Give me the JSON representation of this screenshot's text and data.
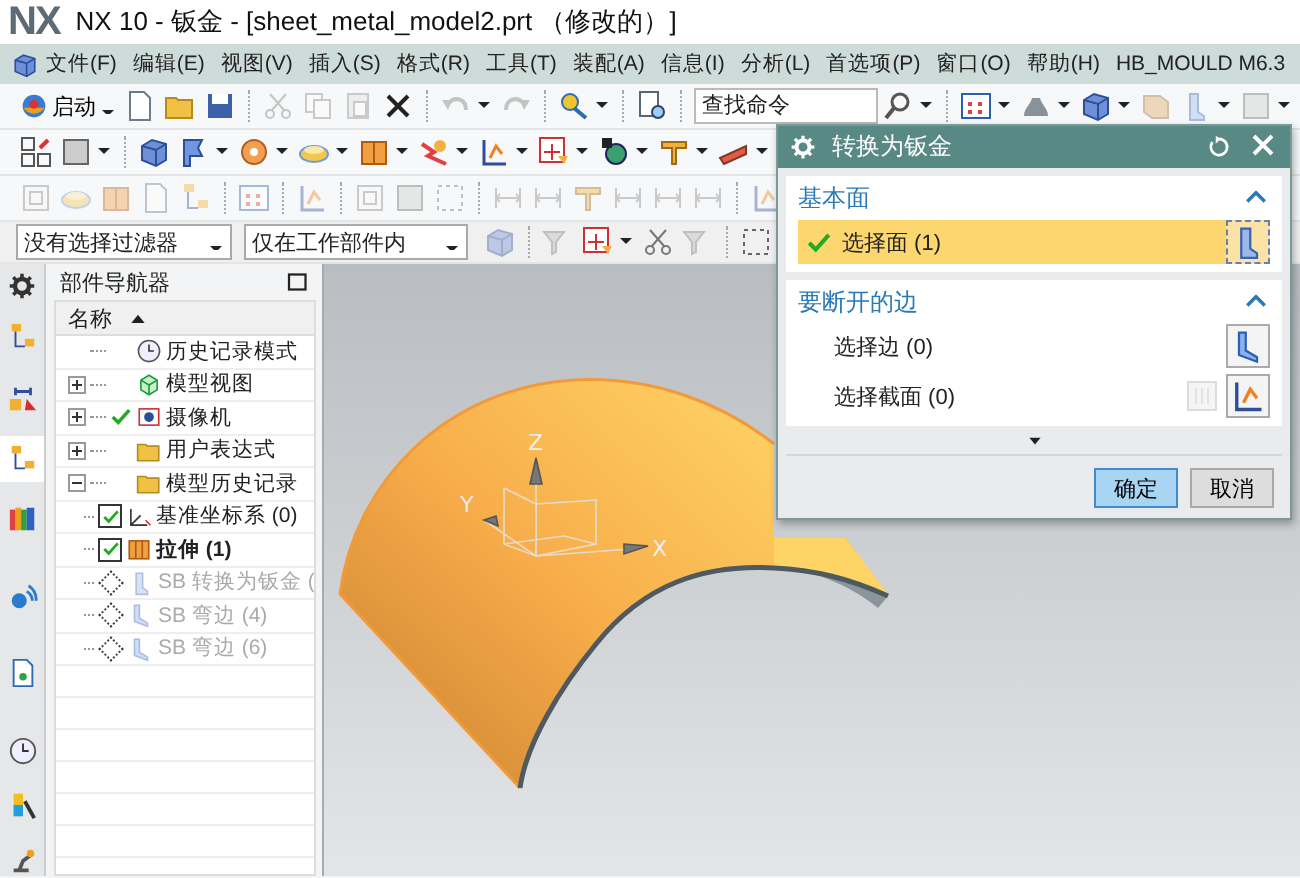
{
  "window": {
    "logo": "NX",
    "title": "NX 10 - 钣金 - [sheet_metal_model2.prt （修改的）]"
  },
  "menu": [
    "文件(F)",
    "编辑(E)",
    "视图(V)",
    "插入(S)",
    "格式(R)",
    "工具(T)",
    "装配(A)",
    "信息(I)",
    "分析(L)",
    "首选项(P)",
    "窗口(O)",
    "帮助(H)",
    "HB_MOULD M6.3"
  ],
  "toolbar": {
    "start_button": "启动",
    "search": {
      "placeholder": "查找命令"
    }
  },
  "filter_bar": {
    "type_filter": "没有选择过滤器",
    "scope_filter": "仅在工作部件内"
  },
  "resource_bar": {
    "tabs": [
      {
        "selected": false
      },
      {
        "selected": false
      },
      {
        "selected": true
      },
      {
        "selected": false
      },
      {
        "selected": false
      },
      {
        "selected": false
      },
      {
        "selected": false
      },
      {
        "selected": false
      },
      {
        "selected": false
      }
    ]
  },
  "part_navigator": {
    "title": "部件导航器",
    "column": "名称",
    "nodes": [
      {
        "label": "历史记录模式",
        "kind": "leaf",
        "checked": false
      },
      {
        "label": "模型视图",
        "kind": "group",
        "expanded": false,
        "checked": false
      },
      {
        "label": "摄像机",
        "kind": "group",
        "expanded": false,
        "checked": true
      },
      {
        "label": "用户表达式",
        "kind": "group",
        "expanded": false,
        "checked": false
      },
      {
        "label": "模型历史记录",
        "kind": "group",
        "expanded": true,
        "checked": false,
        "children": [
          {
            "label": "基准坐标系 (0)",
            "kind": "active",
            "checked": true,
            "current": false
          },
          {
            "label": "拉伸 (1)",
            "kind": "active",
            "checked": true,
            "current": true
          },
          {
            "label": "SB 转换为钣金 (",
            "kind": "inactive",
            "current": false
          },
          {
            "label": "SB 弯边 (4)",
            "kind": "inactive",
            "current": false
          },
          {
            "label": "SB 弯边 (6)",
            "kind": "inactive",
            "current": false
          }
        ]
      }
    ]
  },
  "viewport": {
    "axis_labels": [
      "Z",
      "Y",
      "X"
    ]
  },
  "dialog": {
    "title": "转换为钣金",
    "sections": [
      {
        "title": "基本面",
        "expanded": true,
        "rows": [
          {
            "label": "选择面 (1)",
            "kind": "face",
            "selected": true,
            "done": true
          }
        ]
      },
      {
        "title": "要断开的边",
        "expanded": true,
        "rows": [
          {
            "label": "选择边 (0)",
            "kind": "edge",
            "selected": false,
            "done": false
          },
          {
            "label": "选择截面 (0)",
            "kind": "section",
            "selected": false,
            "done": false
          }
        ]
      }
    ],
    "buttons": [
      {
        "label": "确定",
        "default": true
      },
      {
        "label": "取消",
        "default": false
      }
    ]
  }
}
